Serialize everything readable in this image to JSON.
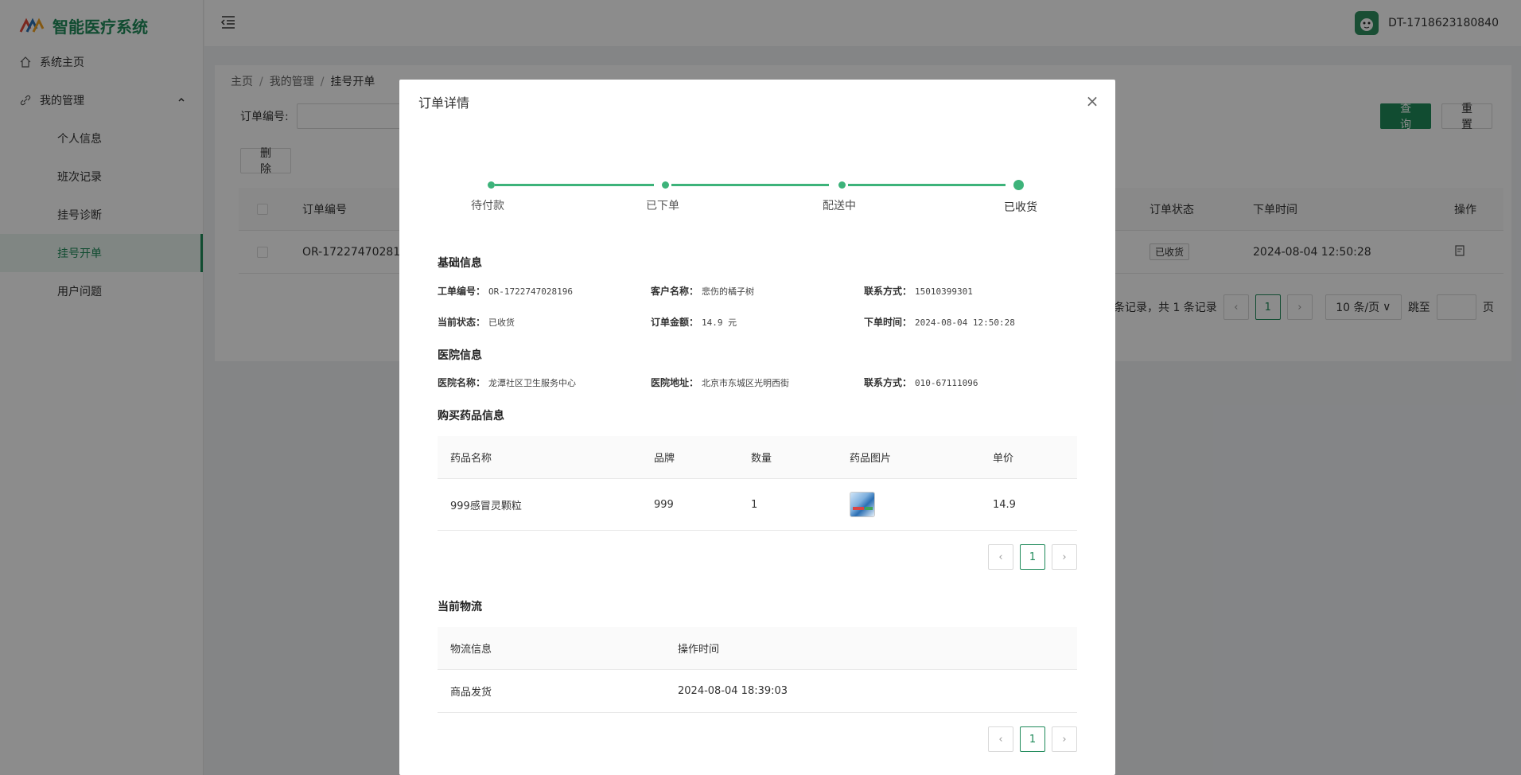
{
  "app": {
    "title": "智能医疗系统",
    "user": "DT-1718623180840"
  },
  "sidebar": {
    "items": [
      {
        "label": "系统主页"
      },
      {
        "label": "我的管理"
      },
      {
        "label": "个人信息"
      },
      {
        "label": "班次记录"
      },
      {
        "label": "挂号诊断"
      },
      {
        "label": "挂号开单"
      },
      {
        "label": "用户问题"
      }
    ]
  },
  "breadcrumb": [
    "主页",
    "我的管理",
    "挂号开单"
  ],
  "search": {
    "label": "订单编号:",
    "value": "",
    "query_label": "查 询",
    "reset_label": "重 置"
  },
  "toolbar": {
    "delete_label": "删 除"
  },
  "table": {
    "headers": {
      "order_no": "订单编号",
      "status": "订单状态",
      "time": "下单时间",
      "action": "操作"
    },
    "rows": [
      {
        "order_no": "OR-1722747028196",
        "status": "已收货",
        "time": "2024-08-04 12:50:28"
      }
    ]
  },
  "pagination": {
    "summary": "条记录，共 1 条记录",
    "page": "1",
    "page_size": "10 条/页",
    "jump_label": "跳至",
    "page_unit": "页"
  },
  "modal": {
    "title": "订单详情",
    "close": "×",
    "steps": [
      "待付款",
      "已下单",
      "配送中",
      "已收货"
    ],
    "sections": {
      "basic": "基础信息",
      "hospital": "医院信息",
      "drugs": "购买药品信息",
      "logistics": "当前物流"
    },
    "basic_info": {
      "order_no": {
        "k": "工单编号：",
        "v": "OR-1722747028196"
      },
      "customer": {
        "k": "客户名称：",
        "v": "悲伤的橘子树"
      },
      "contact": {
        "k": "联系方式：",
        "v": "15010399301"
      },
      "status": {
        "k": "当前状态：",
        "v": "已收货"
      },
      "amount": {
        "k": "订单金额：",
        "v": "14.9 元"
      },
      "time": {
        "k": "下单时间：",
        "v": "2024-08-04 12:50:28"
      }
    },
    "hospital_info": {
      "name": {
        "k": "医院名称：",
        "v": "龙潭社区卫生服务中心"
      },
      "address": {
        "k": "医院地址：",
        "v": "北京市东城区光明西街"
      },
      "contact": {
        "k": "联系方式：",
        "v": "010-67111096"
      }
    },
    "drug_table": {
      "headers": {
        "name": "药品名称",
        "brand": "品牌",
        "qty": "数量",
        "image": "药品图片",
        "price": "单价"
      },
      "rows": [
        {
          "name": "999感冒灵颗粒",
          "brand": "999",
          "qty": "1",
          "price": "14.9"
        }
      ],
      "page": "1"
    },
    "logistics_table": {
      "headers": {
        "info": "物流信息",
        "time": "操作时间"
      },
      "rows": [
        {
          "info": "商品发货",
          "time": "2024-08-04 18:39:03"
        }
      ],
      "page": "1"
    }
  },
  "colors": {
    "accent": "#1f8a5a",
    "step": "#3db37a"
  }
}
